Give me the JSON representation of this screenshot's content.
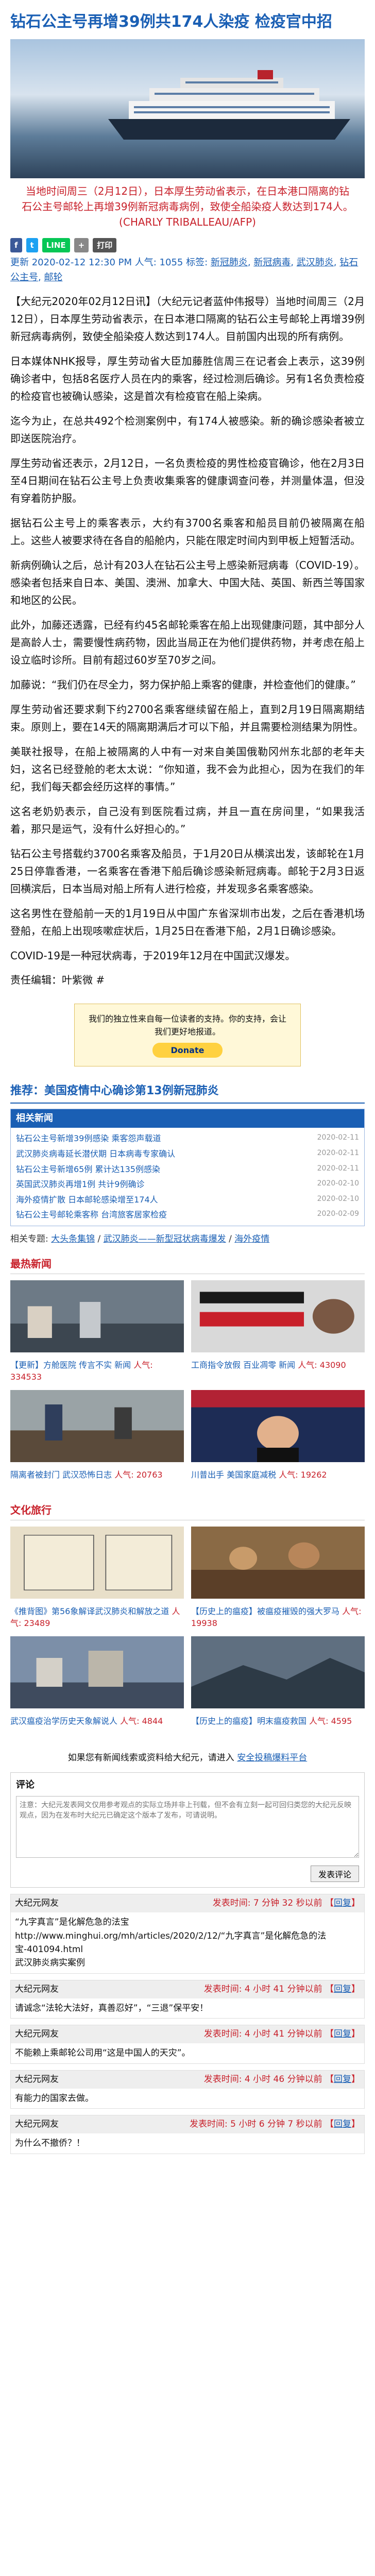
{
  "article": {
    "title": "钻石公主号再增39例共174人染疫 检疫官中招",
    "caption": "当地时间周三（2月12日），日本厚生劳动省表示，在日本港口隔离的钻石公主号邮轮上再增39例新冠病毒病例，致使全船染疫人数达到174人。(CHARLY TRIBALLEAU/AFP)",
    "share": {
      "facebook": "f",
      "twitter": "t",
      "line": "LINE",
      "plus": "+",
      "print": "打印"
    },
    "date_line": "更新 2020-02-12 12:30 PM",
    "tag_prefix": "人气: 1055 标签:",
    "tags": [
      "新冠肺炎",
      "新冠病毒",
      "武汉肺炎",
      "钻石公主号",
      "邮轮"
    ],
    "paragraphs": [
      "【大纪元2020年02月12日讯】（大纪元记者蓝仲伟报导）当地时间周三（2月12日），日本厚生劳动省表示，在日本港口隔离的钻石公主号邮轮上再增39例新冠病毒病例，致使全船染疫人数达到174人。目前国内出现的所有病例。",
      "日本媒体NHK报导，厚生劳动省大臣加藤胜信周三在记者会上表示，这39例确诊者中，包括8名医疗人员在内的乘客，经过检测后确诊。另有1名负责检疫的检疫官也被确认感染，这是首次有检疫官在船上染病。",
      "迄今为止，在总共492个检测案例中，有174人被感染。新的确诊感染者被立即送医院治疗。",
      "厚生劳动省还表示，2月12日，一名负责检疫的男性检疫官确诊，他在2月3日至4日期间在钻石公主号上负责收集乘客的健康调查问卷，并测量体温，但没有穿着防护服。",
      "据钻石公主号上的乘客表示，大约有3700名乘客和船员目前仍被隔离在船上。这些人被要求待在各自的船舱内，只能在限定时间内到甲板上短暂活动。",
      "新病例确认之后，总计有203人在钻石公主号上感染新冠病毒（COVID-19）。感染者包括来自日本、美国、澳洲、加拿大、中国大陆、英国、新西兰等国家和地区的公民。",
      "此外，加藤还透露，已经有约45名邮轮乘客在船上出现健康问题，其中部分人是高龄人士，需要慢性病药物，因此当局正在为他们提供药物，并考虑在船上设立临时诊所。目前有超过60岁至70岁之间。",
      "加藤说：“我们仍在尽全力，努力保护船上乘客的健康，并检查他们的健康。”",
      "厚生劳动省还要求剩下约2700名乘客继续留在船上，直到2月19日隔离期结束。原则上，要在14天的隔离期满后才可以下船，并且需要检测结果为阴性。",
      "美联社报导，在船上被隔离的人中有一对来自美国俄勒冈州东北部的老年夫妇，这名已经登舱的老太太说：“你知道，我不会为此担心，因为在我们的年纪，我们每天都会经历这样的事情。”",
      "这名老奶奶表示，自己没有到医院看过病，并且一直在房间里，“如果我活着，那只是运气，没有什么好担心的。”",
      "钻石公主号搭载约3700名乘客及船员，于1月20日从横滨出发，该邮轮在1月25日停靠香港，一名乘客在香港下船后确诊感染新冠病毒。邮轮于2月3日返回横滨后，日本当局对船上所有人进行检疫，并发现多名乘客感染。",
      "这名男性在登船前一天的1月19日从中国广东省深圳市出发，之后在香港机场登船，在船上出现咳嗽症状后，1月25日在香港下船，2月1日确诊感染。",
      "COVID-19是一种冠状病毒，于2019年12月在中国武汉爆发。"
    ],
    "author_line": "责任编辑：叶紫微 #"
  },
  "donate": {
    "text": "我们的独立性来自每一位读者的支持。你的支持，会让我们更好地报道。",
    "button": "Donate"
  },
  "recommend": {
    "title": "推荐：美国疫情中心确诊第13例新冠肺炎",
    "related_head": "相关新闻",
    "related": [
      {
        "t": "钻石公主号新增39例感染 乘客怨声载道",
        "d": "2020-02-11"
      },
      {
        "t": "武汉肺炎病毒延长潜伏期 日本病毒专家确认",
        "d": "2020-02-11"
      },
      {
        "t": "钻石公主号新增65例 累计达135例感染",
        "d": "2020-02-11"
      },
      {
        "t": "英国武汉肺炎再增1例 共计9例确诊",
        "d": "2020-02-10"
      },
      {
        "t": "海外疫情扩散 日本邮轮感染增至174人",
        "d": "2020-02-10"
      },
      {
        "t": "钻石公主号邮轮乘客称 台湾旅客居家检疫",
        "d": "2020-02-09"
      }
    ],
    "tag_label": "相关专题",
    "tag_links": [
      "大头条集锦",
      "武汉肺炎——新型冠状病毒爆发",
      "海外疫情"
    ]
  },
  "popular": {
    "head": "最热新闻",
    "items": [
      {
        "cap": "【更新】方舱医院 传言不实 新闻",
        "pop": "人气: 334533"
      },
      {
        "cap": "工商指令放假 百业凋零 新闻",
        "pop": "人气: 43090"
      },
      {
        "cap": "隔离者被封门 武汉恐怖日志",
        "pop": "人气: 20763"
      },
      {
        "cap": "川普出手 美国家庭减税",
        "pop": "人气: 19262"
      }
    ]
  },
  "culture": {
    "head": "文化旅行",
    "items": [
      {
        "cap": "《推背图》第56象解译武汉肺炎和解放之道",
        "pop": "人气: 23489"
      },
      {
        "cap": "【历史上的瘟疫】被瘟疫摧毁的强大罗马",
        "pop": "人气: 19938"
      },
      {
        "cap": "武汉瘟疫治学历史天象解说人",
        "pop": "人气: 4844"
      },
      {
        "cap": "【历史上的瘟疫】明末瘟疫救国",
        "pop": "人气: 4595"
      }
    ]
  },
  "notice": {
    "text": "如果您有新闻线索或资料给大纪元，请进入",
    "link": "安全投稿爆料平台"
  },
  "comment": {
    "label": "评论",
    "placeholder": "注意：大纪元发表网文仅用参考观点的实际立场并非上刊载，但不会有立刻一起可回归类您的大纪元反映观点，因为在发布时大纪元已确定这个版本了发布，可请说明。",
    "submit": "发表评论"
  },
  "comments": [
    {
      "user": "大纪元网友",
      "time": "发表时间: 7 分钟 32 秒以前",
      "reply": "回复",
      "body": "“九字真言”是化解危急的法宝\nhttp://www.minghui.org/mh/articles/2020/2/12/“九字真言”是化解危急的法宝-401094.html\n武汉肺炎病实案例"
    },
    {
      "user": "大纪元网友",
      "time": "发表时间: 4 小时 41 分钟以前",
      "reply": "回复",
      "body": "请诚念“法轮大法好，真善忍好”，“三退”保平安！"
    },
    {
      "user": "大纪元网友",
      "time": "发表时间: 4 小时 41 分钟以前",
      "reply": "回复",
      "body": "不能赖上乘邮轮公司用“这是中国人的天灾”。"
    },
    {
      "user": "大纪元网友",
      "time": "发表时间: 4 小时 46 分钟以前",
      "reply": "回复",
      "body": "有能力的国家去做。"
    },
    {
      "user": "大纪元网友",
      "time": "发表时间: 5 小时 6 分钟 7 秒以前",
      "reply": "回复",
      "body": "为什么不撤侨？！"
    }
  ],
  "colors": {
    "link": "#1a5fb4",
    "accent": "#c8202a"
  }
}
